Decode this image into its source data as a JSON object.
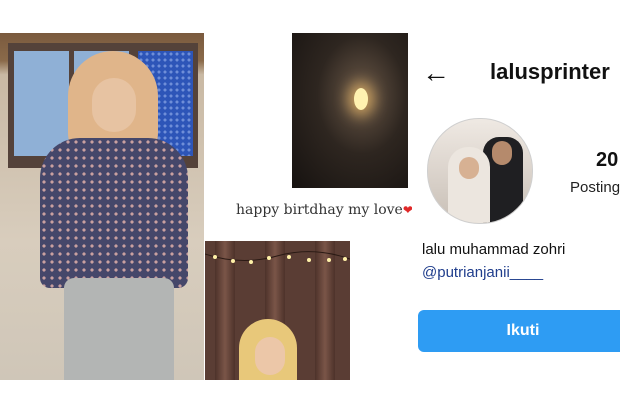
{
  "caption": "happy birtdhay my love",
  "caption_heart": "heart-icon",
  "profile": {
    "username": "lalusprinter",
    "posts_count": "20",
    "posts_label": "Posting",
    "full_name": "lalu muhammad zohri",
    "mention": "@putrianjanii____",
    "follow_button": "Ikuti",
    "follow_color": "#2e9cf3",
    "back_icon": "back-arrow-icon"
  }
}
